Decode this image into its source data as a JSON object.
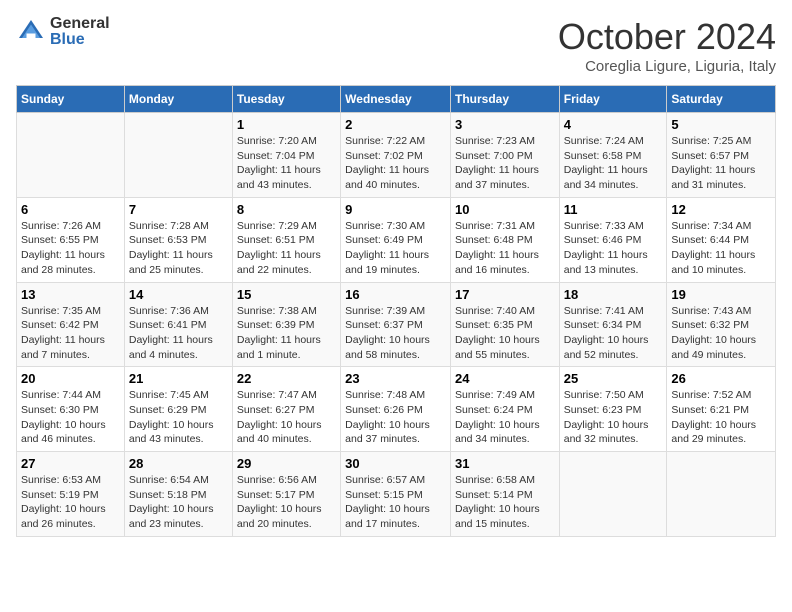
{
  "logo": {
    "general": "General",
    "blue": "Blue"
  },
  "title": "October 2024",
  "subtitle": "Coreglia Ligure, Liguria, Italy",
  "days_of_week": [
    "Sunday",
    "Monday",
    "Tuesday",
    "Wednesday",
    "Thursday",
    "Friday",
    "Saturday"
  ],
  "weeks": [
    [
      {
        "day": "",
        "sunrise": "",
        "sunset": "",
        "daylight": ""
      },
      {
        "day": "",
        "sunrise": "",
        "sunset": "",
        "daylight": ""
      },
      {
        "day": "1",
        "sunrise": "Sunrise: 7:20 AM",
        "sunset": "Sunset: 7:04 PM",
        "daylight": "Daylight: 11 hours and 43 minutes."
      },
      {
        "day": "2",
        "sunrise": "Sunrise: 7:22 AM",
        "sunset": "Sunset: 7:02 PM",
        "daylight": "Daylight: 11 hours and 40 minutes."
      },
      {
        "day": "3",
        "sunrise": "Sunrise: 7:23 AM",
        "sunset": "Sunset: 7:00 PM",
        "daylight": "Daylight: 11 hours and 37 minutes."
      },
      {
        "day": "4",
        "sunrise": "Sunrise: 7:24 AM",
        "sunset": "Sunset: 6:58 PM",
        "daylight": "Daylight: 11 hours and 34 minutes."
      },
      {
        "day": "5",
        "sunrise": "Sunrise: 7:25 AM",
        "sunset": "Sunset: 6:57 PM",
        "daylight": "Daylight: 11 hours and 31 minutes."
      }
    ],
    [
      {
        "day": "6",
        "sunrise": "Sunrise: 7:26 AM",
        "sunset": "Sunset: 6:55 PM",
        "daylight": "Daylight: 11 hours and 28 minutes."
      },
      {
        "day": "7",
        "sunrise": "Sunrise: 7:28 AM",
        "sunset": "Sunset: 6:53 PM",
        "daylight": "Daylight: 11 hours and 25 minutes."
      },
      {
        "day": "8",
        "sunrise": "Sunrise: 7:29 AM",
        "sunset": "Sunset: 6:51 PM",
        "daylight": "Daylight: 11 hours and 22 minutes."
      },
      {
        "day": "9",
        "sunrise": "Sunrise: 7:30 AM",
        "sunset": "Sunset: 6:49 PM",
        "daylight": "Daylight: 11 hours and 19 minutes."
      },
      {
        "day": "10",
        "sunrise": "Sunrise: 7:31 AM",
        "sunset": "Sunset: 6:48 PM",
        "daylight": "Daylight: 11 hours and 16 minutes."
      },
      {
        "day": "11",
        "sunrise": "Sunrise: 7:33 AM",
        "sunset": "Sunset: 6:46 PM",
        "daylight": "Daylight: 11 hours and 13 minutes."
      },
      {
        "day": "12",
        "sunrise": "Sunrise: 7:34 AM",
        "sunset": "Sunset: 6:44 PM",
        "daylight": "Daylight: 11 hours and 10 minutes."
      }
    ],
    [
      {
        "day": "13",
        "sunrise": "Sunrise: 7:35 AM",
        "sunset": "Sunset: 6:42 PM",
        "daylight": "Daylight: 11 hours and 7 minutes."
      },
      {
        "day": "14",
        "sunrise": "Sunrise: 7:36 AM",
        "sunset": "Sunset: 6:41 PM",
        "daylight": "Daylight: 11 hours and 4 minutes."
      },
      {
        "day": "15",
        "sunrise": "Sunrise: 7:38 AM",
        "sunset": "Sunset: 6:39 PM",
        "daylight": "Daylight: 11 hours and 1 minute."
      },
      {
        "day": "16",
        "sunrise": "Sunrise: 7:39 AM",
        "sunset": "Sunset: 6:37 PM",
        "daylight": "Daylight: 10 hours and 58 minutes."
      },
      {
        "day": "17",
        "sunrise": "Sunrise: 7:40 AM",
        "sunset": "Sunset: 6:35 PM",
        "daylight": "Daylight: 10 hours and 55 minutes."
      },
      {
        "day": "18",
        "sunrise": "Sunrise: 7:41 AM",
        "sunset": "Sunset: 6:34 PM",
        "daylight": "Daylight: 10 hours and 52 minutes."
      },
      {
        "day": "19",
        "sunrise": "Sunrise: 7:43 AM",
        "sunset": "Sunset: 6:32 PM",
        "daylight": "Daylight: 10 hours and 49 minutes."
      }
    ],
    [
      {
        "day": "20",
        "sunrise": "Sunrise: 7:44 AM",
        "sunset": "Sunset: 6:30 PM",
        "daylight": "Daylight: 10 hours and 46 minutes."
      },
      {
        "day": "21",
        "sunrise": "Sunrise: 7:45 AM",
        "sunset": "Sunset: 6:29 PM",
        "daylight": "Daylight: 10 hours and 43 minutes."
      },
      {
        "day": "22",
        "sunrise": "Sunrise: 7:47 AM",
        "sunset": "Sunset: 6:27 PM",
        "daylight": "Daylight: 10 hours and 40 minutes."
      },
      {
        "day": "23",
        "sunrise": "Sunrise: 7:48 AM",
        "sunset": "Sunset: 6:26 PM",
        "daylight": "Daylight: 10 hours and 37 minutes."
      },
      {
        "day": "24",
        "sunrise": "Sunrise: 7:49 AM",
        "sunset": "Sunset: 6:24 PM",
        "daylight": "Daylight: 10 hours and 34 minutes."
      },
      {
        "day": "25",
        "sunrise": "Sunrise: 7:50 AM",
        "sunset": "Sunset: 6:23 PM",
        "daylight": "Daylight: 10 hours and 32 minutes."
      },
      {
        "day": "26",
        "sunrise": "Sunrise: 7:52 AM",
        "sunset": "Sunset: 6:21 PM",
        "daylight": "Daylight: 10 hours and 29 minutes."
      }
    ],
    [
      {
        "day": "27",
        "sunrise": "Sunrise: 6:53 AM",
        "sunset": "Sunset: 5:19 PM",
        "daylight": "Daylight: 10 hours and 26 minutes."
      },
      {
        "day": "28",
        "sunrise": "Sunrise: 6:54 AM",
        "sunset": "Sunset: 5:18 PM",
        "daylight": "Daylight: 10 hours and 23 minutes."
      },
      {
        "day": "29",
        "sunrise": "Sunrise: 6:56 AM",
        "sunset": "Sunset: 5:17 PM",
        "daylight": "Daylight: 10 hours and 20 minutes."
      },
      {
        "day": "30",
        "sunrise": "Sunrise: 6:57 AM",
        "sunset": "Sunset: 5:15 PM",
        "daylight": "Daylight: 10 hours and 17 minutes."
      },
      {
        "day": "31",
        "sunrise": "Sunrise: 6:58 AM",
        "sunset": "Sunset: 5:14 PM",
        "daylight": "Daylight: 10 hours and 15 minutes."
      },
      {
        "day": "",
        "sunrise": "",
        "sunset": "",
        "daylight": ""
      },
      {
        "day": "",
        "sunrise": "",
        "sunset": "",
        "daylight": ""
      }
    ]
  ]
}
